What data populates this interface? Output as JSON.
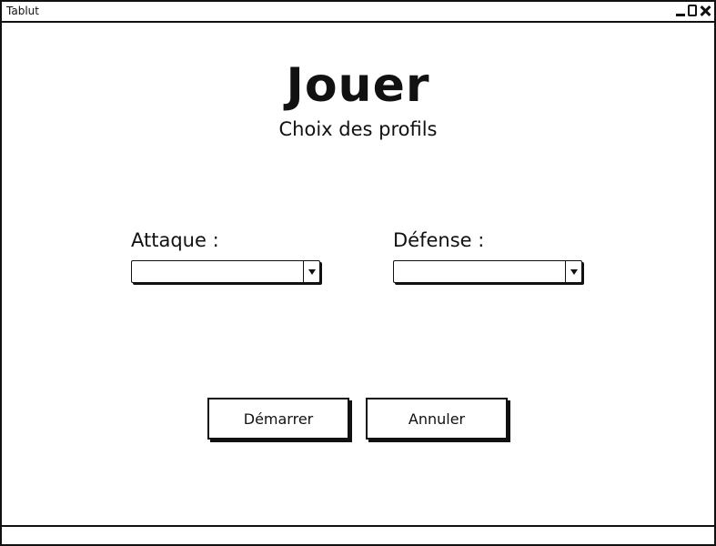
{
  "window": {
    "title": "Tablut",
    "controls": [
      "minimize-icon",
      "maximize-icon",
      "close-icon"
    ]
  },
  "main": {
    "heading": "Jouer",
    "subheading": "Choix des profils"
  },
  "profiles": {
    "attack": {
      "label": "Attaque :",
      "value": ""
    },
    "defense": {
      "label": "Défense :",
      "value": ""
    }
  },
  "actions": {
    "start_label": "Démarrer",
    "cancel_label": "Annuler"
  }
}
